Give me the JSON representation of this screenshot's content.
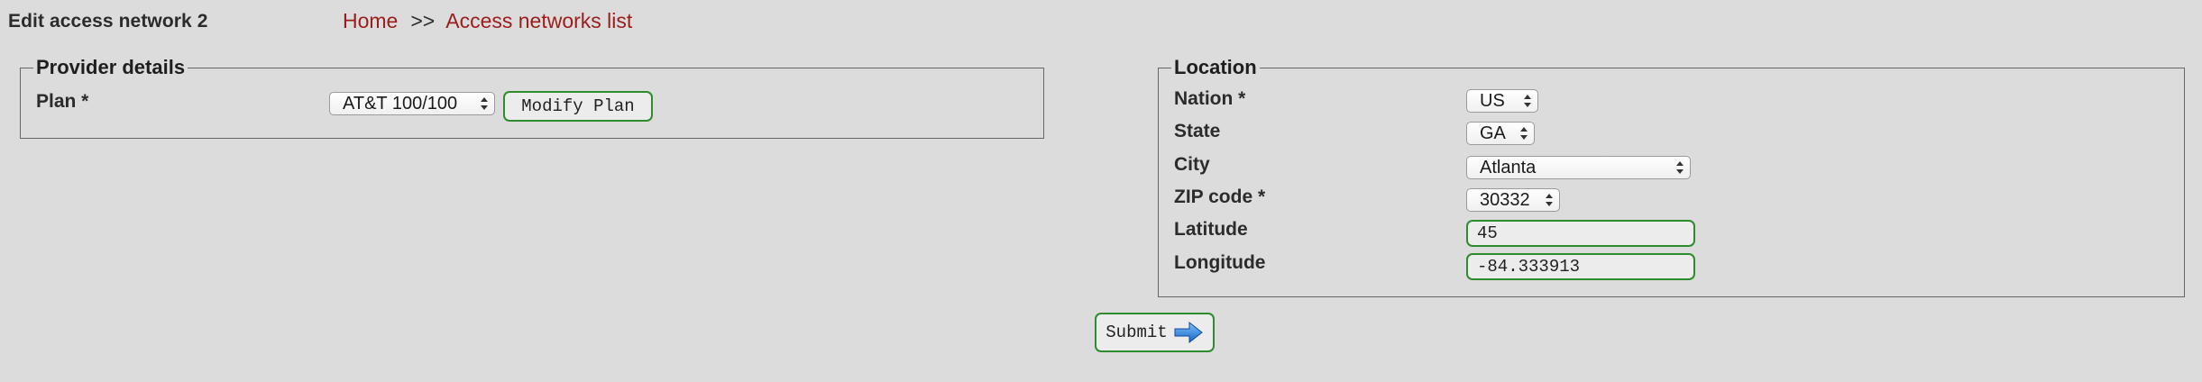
{
  "header": {
    "title": "Edit access network 2",
    "breadcrumb": {
      "home": "Home",
      "separator": ">>",
      "list": "Access networks list"
    }
  },
  "provider": {
    "legend": "Provider details",
    "plan_label": "Plan *",
    "plan_value": "AT&T 100/100",
    "modify_label": "Modify Plan"
  },
  "location": {
    "legend": "Location",
    "nation_label": "Nation *",
    "nation_value": "US",
    "state_label": "State",
    "state_value": "GA",
    "city_label": "City",
    "city_value": "Atlanta",
    "zip_label": "ZIP code *",
    "zip_value": "30332",
    "latitude_label": "Latitude",
    "latitude_value": "45",
    "longitude_label": "Longitude",
    "longitude_value": "-84.333913"
  },
  "submit": {
    "label": "Submit",
    "icon": "arrow-right-icon"
  },
  "colors": {
    "background": "#dcdcdc",
    "link": "#9c1c1c",
    "accent_border": "#2e8b2e",
    "arrow_blue": "#1e88e5"
  }
}
